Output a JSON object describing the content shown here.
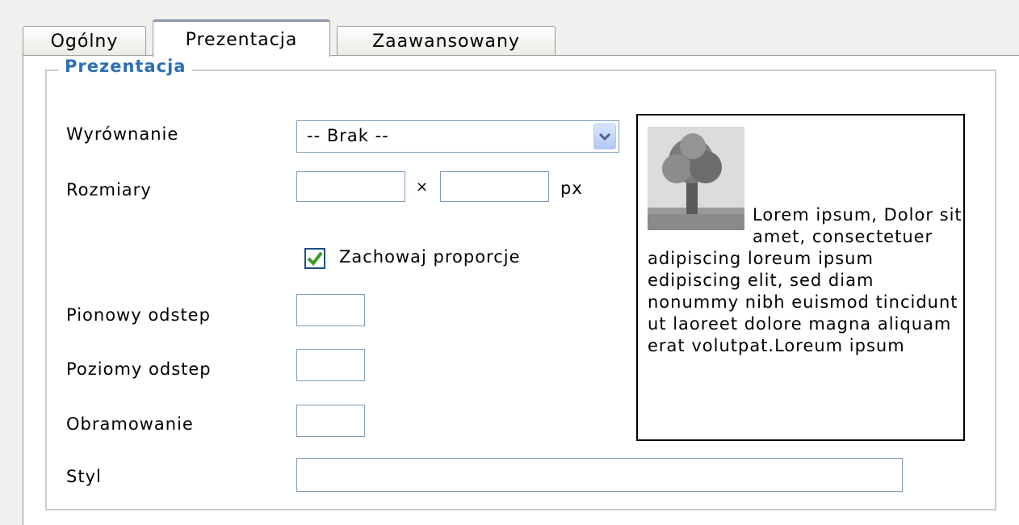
{
  "tabs": [
    {
      "label": "Ogólny",
      "active": false
    },
    {
      "label": "Prezentacja",
      "active": true
    },
    {
      "label": "Zaawansowany",
      "active": false
    }
  ],
  "fieldset": {
    "legend": "Prezentacja"
  },
  "form": {
    "alignment": {
      "label": "Wyrównanie",
      "value": "-- Brak --"
    },
    "dimensions": {
      "label": "Rozmiary",
      "width": "",
      "height": "",
      "separator": "×",
      "unit": "px"
    },
    "keep_proportions": {
      "label": "Zachowaj proporcje",
      "checked": true
    },
    "vspace": {
      "label": "Pionowy odstep",
      "value": ""
    },
    "hspace": {
      "label": "Poziomy odstep",
      "value": ""
    },
    "border": {
      "label": "Obramowanie",
      "value": ""
    },
    "style": {
      "label": "Styl",
      "value": ""
    }
  },
  "preview": {
    "image_icon": "tree-image-icon",
    "text": "Lorem ipsum, Dolor sit amet, consectetuer adipiscing loreum ipsum edipiscing elit, sed diam nonummy nibh euismod tincidunt ut laoreet dolore magna aliquam erat volutpat.Loreum ipsum"
  },
  "colors": {
    "legend": "#2b6fb6",
    "checkmark": "#3a9a22",
    "input_border": "#7f9db9"
  }
}
